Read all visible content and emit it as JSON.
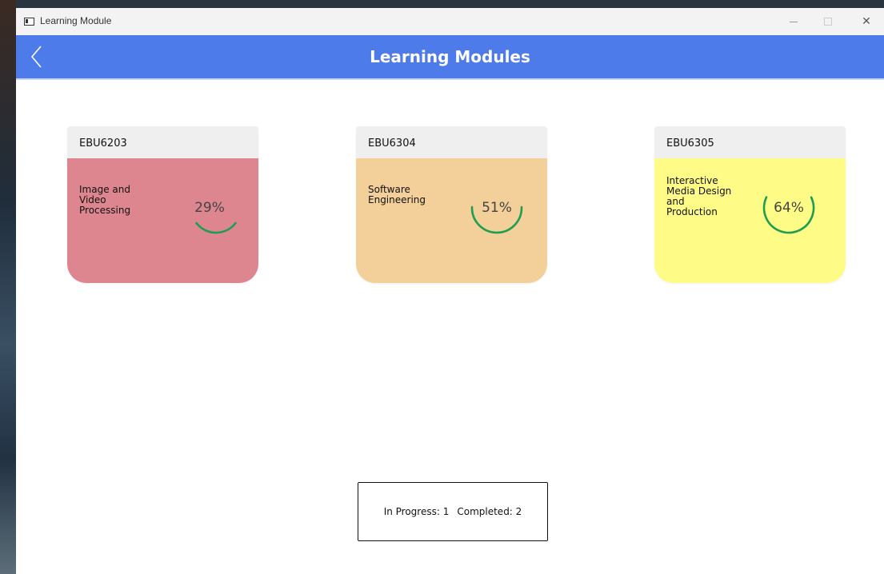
{
  "window": {
    "title": "Learning Module"
  },
  "header": {
    "title": "Learning Modules",
    "back_icon": "chevron-left-icon"
  },
  "colors": {
    "header_bg": "#4e7bea",
    "progress_ring": "#1e9e50",
    "card_header_bg": "#efefef"
  },
  "modules": [
    {
      "code": "EBU6203",
      "name": "Image  and\nVideo\nProcessing",
      "progress_text": "29%",
      "progress": 0.29,
      "color": "#de8690"
    },
    {
      "code": "EBU6304",
      "name": "Software\nEngineering",
      "progress_text": "51%",
      "progress": 0.51,
      "color": "#f3cf99"
    },
    {
      "code": "EBU6305",
      "name": "Interactive\nMedia Design\nand\nProduction",
      "progress_text": "64%",
      "progress": 0.64,
      "color": "#fefc86"
    }
  ],
  "summary": {
    "in_progress": "In Progress: 1",
    "completed": "Completed: 2"
  }
}
